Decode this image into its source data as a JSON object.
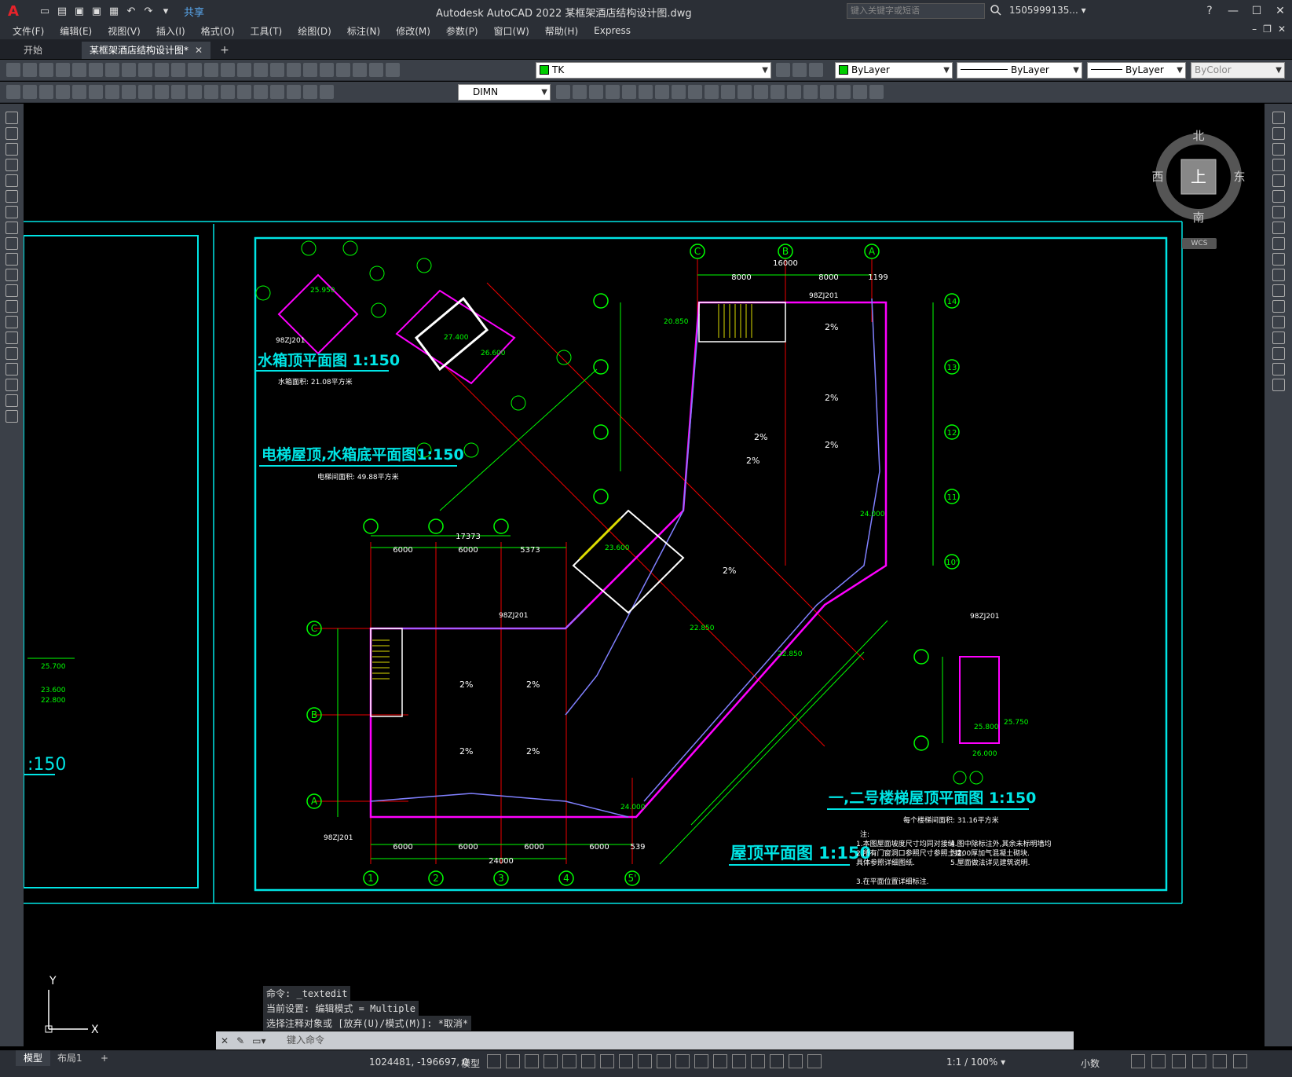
{
  "app": {
    "title": "Autodesk AutoCAD 2022    某框架酒店结构设计图.dwg",
    "share_label": "共享",
    "search_placeholder": "键入关键字或短语",
    "user": "1505999135... ▾"
  },
  "menu": [
    "文件(F)",
    "编辑(E)",
    "视图(V)",
    "插入(I)",
    "格式(O)",
    "工具(T)",
    "绘图(D)",
    "标注(N)",
    "修改(M)",
    "参数(P)",
    "窗口(W)",
    "帮助(H)",
    "Express"
  ],
  "tabs": {
    "start": "开始",
    "doc": "某框架酒店结构设计图*"
  },
  "toolbar": {
    "layer": "TK",
    "color": "ByLayer",
    "linetype": "ByLayer",
    "lineweight": "ByLayer",
    "plotstyle": "ByColor",
    "dimstyle": "DIMN"
  },
  "viewcube": {
    "north": "北",
    "south": "南",
    "east": "东",
    "west": "西",
    "top": "上",
    "wcs": "WCS"
  },
  "drawing": {
    "titles": {
      "water_tank_top": "水箱顶平面图 1:150",
      "elevator_roof": "电梯屋顶,水箱底平面图1:150",
      "stair_roof": "一,二号楼梯屋顶平面图 1:150",
      "roof_plan": "屋顶平面图 1:150",
      "left_partial": ":150"
    },
    "area_notes": {
      "water_tank": "水箱面积: 21.08平方米",
      "elevator": "电梯间面积: 49.88平方米",
      "stair": "每个楼梯间面积: 31.16平方米"
    },
    "dims_bottom": [
      "6000",
      "6000",
      "6000",
      "6000",
      "539"
    ],
    "dims_total": "24000",
    "axes_bottom": [
      "1",
      "2",
      "3",
      "4",
      "5'"
    ],
    "axes_left": [
      "C",
      "B",
      "A"
    ],
    "axes_top": [
      "C",
      "B",
      "A"
    ],
    "axes_right": [
      "14",
      "13",
      "12",
      "11",
      "10'"
    ],
    "dims_top_left": [
      "6000",
      "6000",
      "5373"
    ],
    "dims_top_left_total": "17373",
    "dims_right_top": [
      "8000",
      "8000",
      "1199"
    ],
    "dims_right_top_total": "16000",
    "elevations": [
      "27.400",
      "26.600",
      "25.950",
      "24.000",
      "22.850",
      "25.700",
      "23.600",
      "22.800",
      "25.800",
      "26.000",
      "25.750",
      "20.850",
      "23.600"
    ],
    "slope": "2%",
    "ref": "98ZJ201",
    "notes": [
      "注:",
      "1.本图屋面坡度尺寸均同对接缝.",
      "2.所有门窗洞口参照尺寸参照土建,",
      "   具体参照详细图纸.",
      "3.在平面位置详细标注.",
      "4.图中除标注外,其余未标明墙均",
      "   为200厚加气混凝土砌块.",
      "5.屋面做法详见建筑说明."
    ]
  },
  "ucs": {
    "x": "X",
    "y": "Y"
  },
  "command": {
    "history": [
      "命令: _textedit",
      "当前设置: 编辑模式 = Multiple",
      "选择注释对象或 [放弃(U)/模式(M)]: *取消*"
    ],
    "placeholder": "键入命令"
  },
  "status": {
    "tabs": [
      "模型",
      "布局1"
    ],
    "coords": "1024481, -196697, 0",
    "model": "模型",
    "scale": "1:1 / 100% ▾",
    "units": "小数"
  }
}
